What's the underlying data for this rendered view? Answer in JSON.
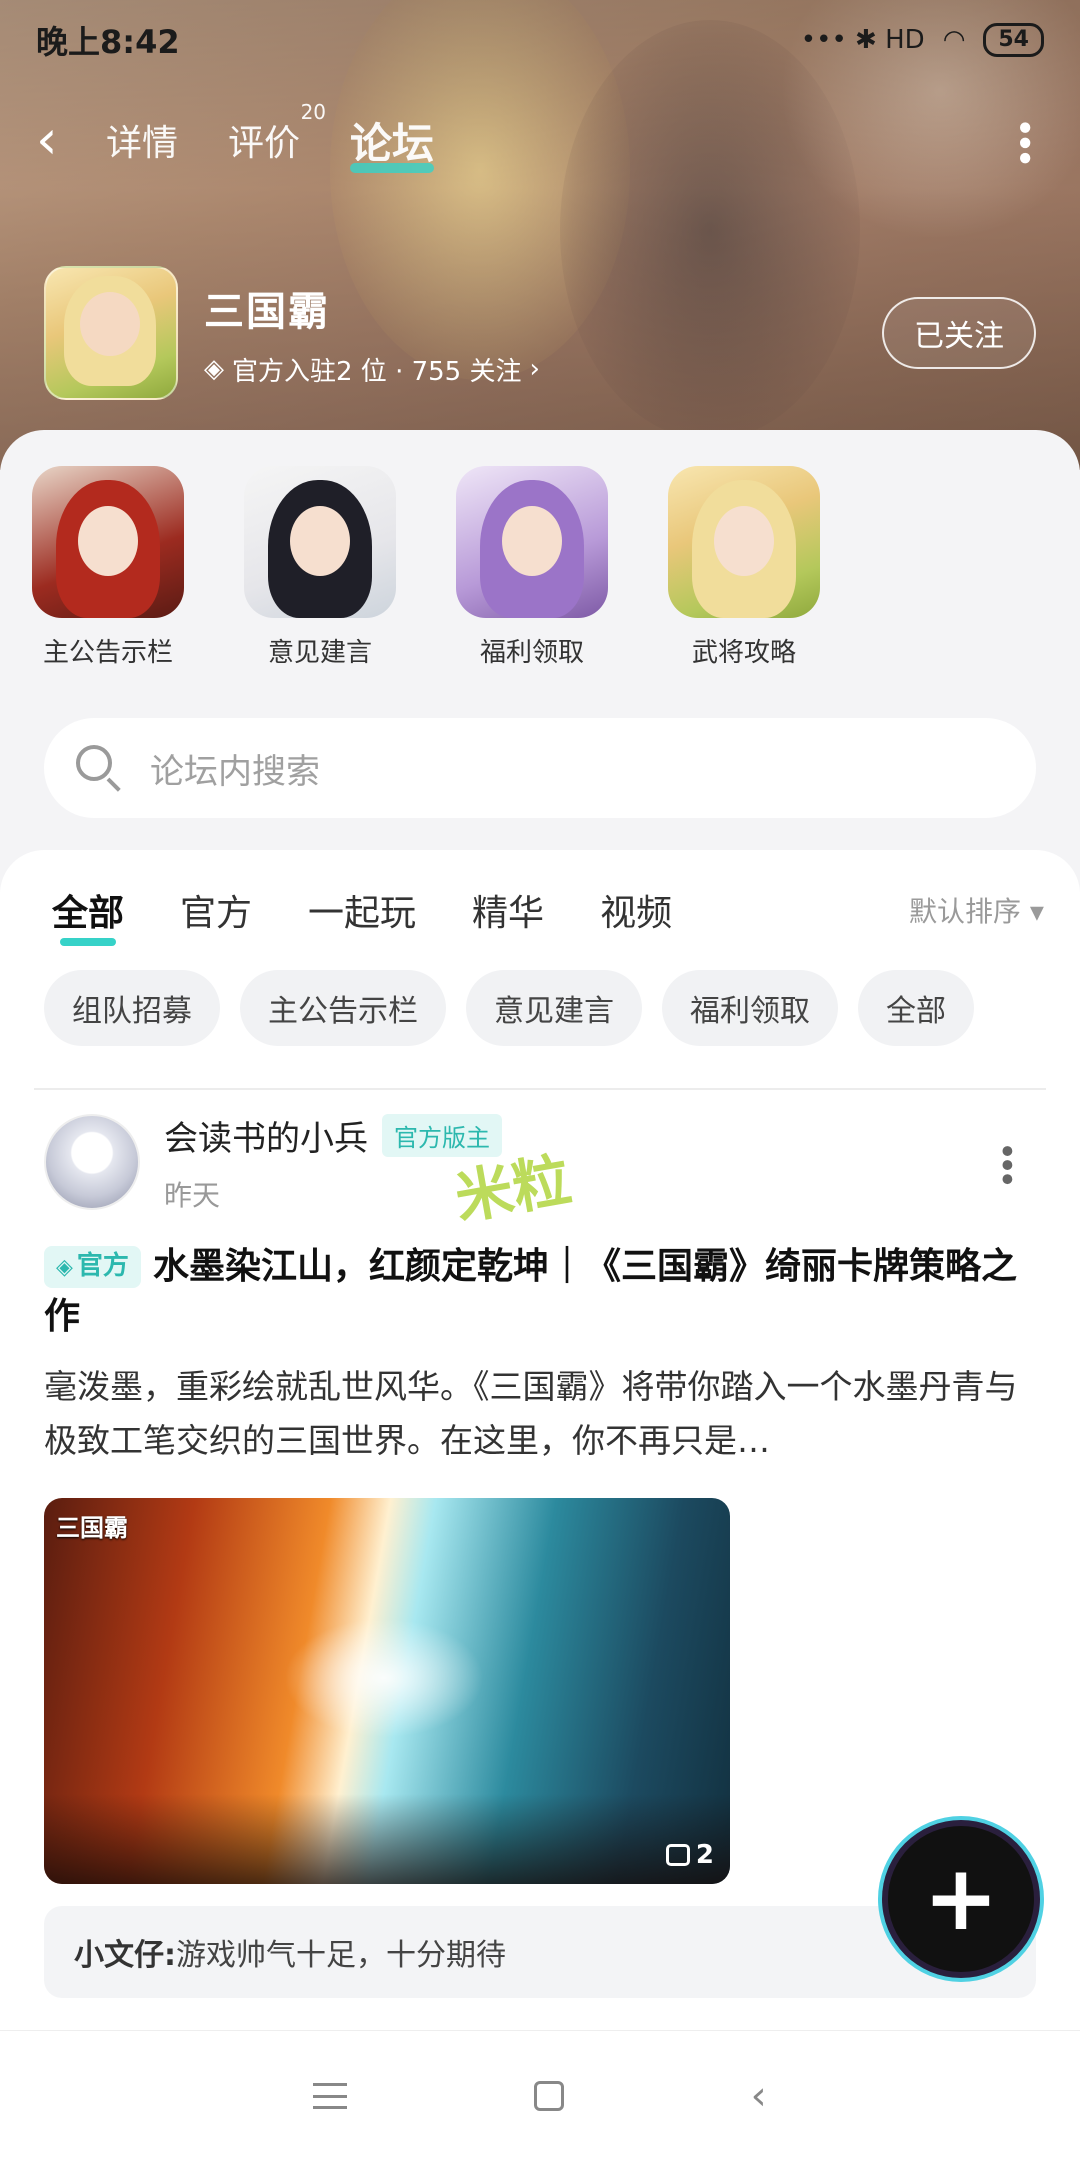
{
  "status": {
    "time": "晚上8:42",
    "signal_icons": "••• ✱ HD",
    "battery": "54"
  },
  "nav": {
    "tabs": [
      {
        "label": "详情"
      },
      {
        "label": "评价",
        "badge": "20"
      },
      {
        "label": "论坛"
      }
    ],
    "active_tab": "论坛"
  },
  "game": {
    "name": "三国霸",
    "meta": "官方入驻2 位 · 755 关注",
    "follow_label": "已关注"
  },
  "sections": [
    {
      "label": "主公告示栏"
    },
    {
      "label": "意见建言"
    },
    {
      "label": "福利领取"
    },
    {
      "label": "武将攻略"
    }
  ],
  "search": {
    "placeholder": "论坛内搜索"
  },
  "filter_tabs": [
    {
      "label": "全部"
    },
    {
      "label": "官方"
    },
    {
      "label": "一起玩"
    },
    {
      "label": "精华"
    },
    {
      "label": "视频"
    }
  ],
  "sort_label": "默认排序 ▾",
  "chips": [
    {
      "label": "组队招募"
    },
    {
      "label": "主公告示栏"
    },
    {
      "label": "意见建言"
    },
    {
      "label": "福利领取"
    },
    {
      "label": "全部"
    }
  ],
  "post": {
    "author": "会读书的小兵",
    "author_badge": "官方版主",
    "time": "昨天",
    "watermark": "米粒",
    "tag": "官方",
    "title": "水墨染江山，红颜定乾坤｜《三国霸》绮丽卡牌策略之作",
    "body": "毫泼墨，重彩绘就乱世风华。《三国霸》将带你踏入一个水墨丹青与极致工笔交织的三国世界。在这里，你不再只是…",
    "image_logo": "三国霸",
    "image_count": "2",
    "comment_author": "小文仔:",
    "comment_text": "游戏帅气十足，十分期待"
  },
  "fab_label": "+",
  "colors": {
    "accent": "#36d2c8",
    "badge_text": "#2cb8ae",
    "badge_bg": "#e2f7f5"
  },
  "icons": [
    "back-icon",
    "more-icon",
    "diamond-icon",
    "chevron-right-icon",
    "search-icon",
    "caret-down-icon",
    "image-icon",
    "plus-icon",
    "menu-icon",
    "home-icon",
    "nav-back-icon"
  ]
}
